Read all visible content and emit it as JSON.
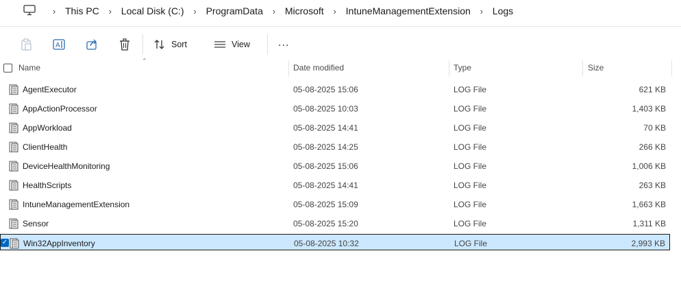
{
  "breadcrumb": {
    "items": [
      "This PC",
      "Local Disk (C:)",
      "ProgramData",
      "Microsoft",
      "IntuneManagementExtension",
      "Logs"
    ]
  },
  "toolbar": {
    "sort_label": "Sort",
    "view_label": "View",
    "more_label": "..."
  },
  "columns": {
    "name": "Name",
    "date": "Date modified",
    "type": "Type",
    "size": "Size"
  },
  "files": [
    {
      "name": "AgentExecutor",
      "date": "05-08-2025 15:06",
      "type": "LOG File",
      "size": "621 KB"
    },
    {
      "name": "AppActionProcessor",
      "date": "05-08-2025 10:03",
      "type": "LOG File",
      "size": "1,403 KB"
    },
    {
      "name": "AppWorkload",
      "date": "05-08-2025 14:41",
      "type": "LOG File",
      "size": "70 KB"
    },
    {
      "name": "ClientHealth",
      "date": "05-08-2025 14:25",
      "type": "LOG File",
      "size": "266 KB"
    },
    {
      "name": "DeviceHealthMonitoring",
      "date": "05-08-2025 15:06",
      "type": "LOG File",
      "size": "1,006 KB"
    },
    {
      "name": "HealthScripts",
      "date": "05-08-2025 14:41",
      "type": "LOG File",
      "size": "263 KB"
    },
    {
      "name": "IntuneManagementExtension",
      "date": "05-08-2025 15:09",
      "type": "LOG File",
      "size": "1,663 KB"
    },
    {
      "name": "Sensor",
      "date": "05-08-2025 15:20",
      "type": "LOG File",
      "size": "1,311 KB"
    },
    {
      "name": "Win32AppInventory",
      "date": "05-08-2025 10:32",
      "type": "LOG File",
      "size": "2,993 KB"
    }
  ],
  "selected_index": 8,
  "colors": {
    "selection_bg": "#cce8ff",
    "accent": "#0067c0"
  }
}
